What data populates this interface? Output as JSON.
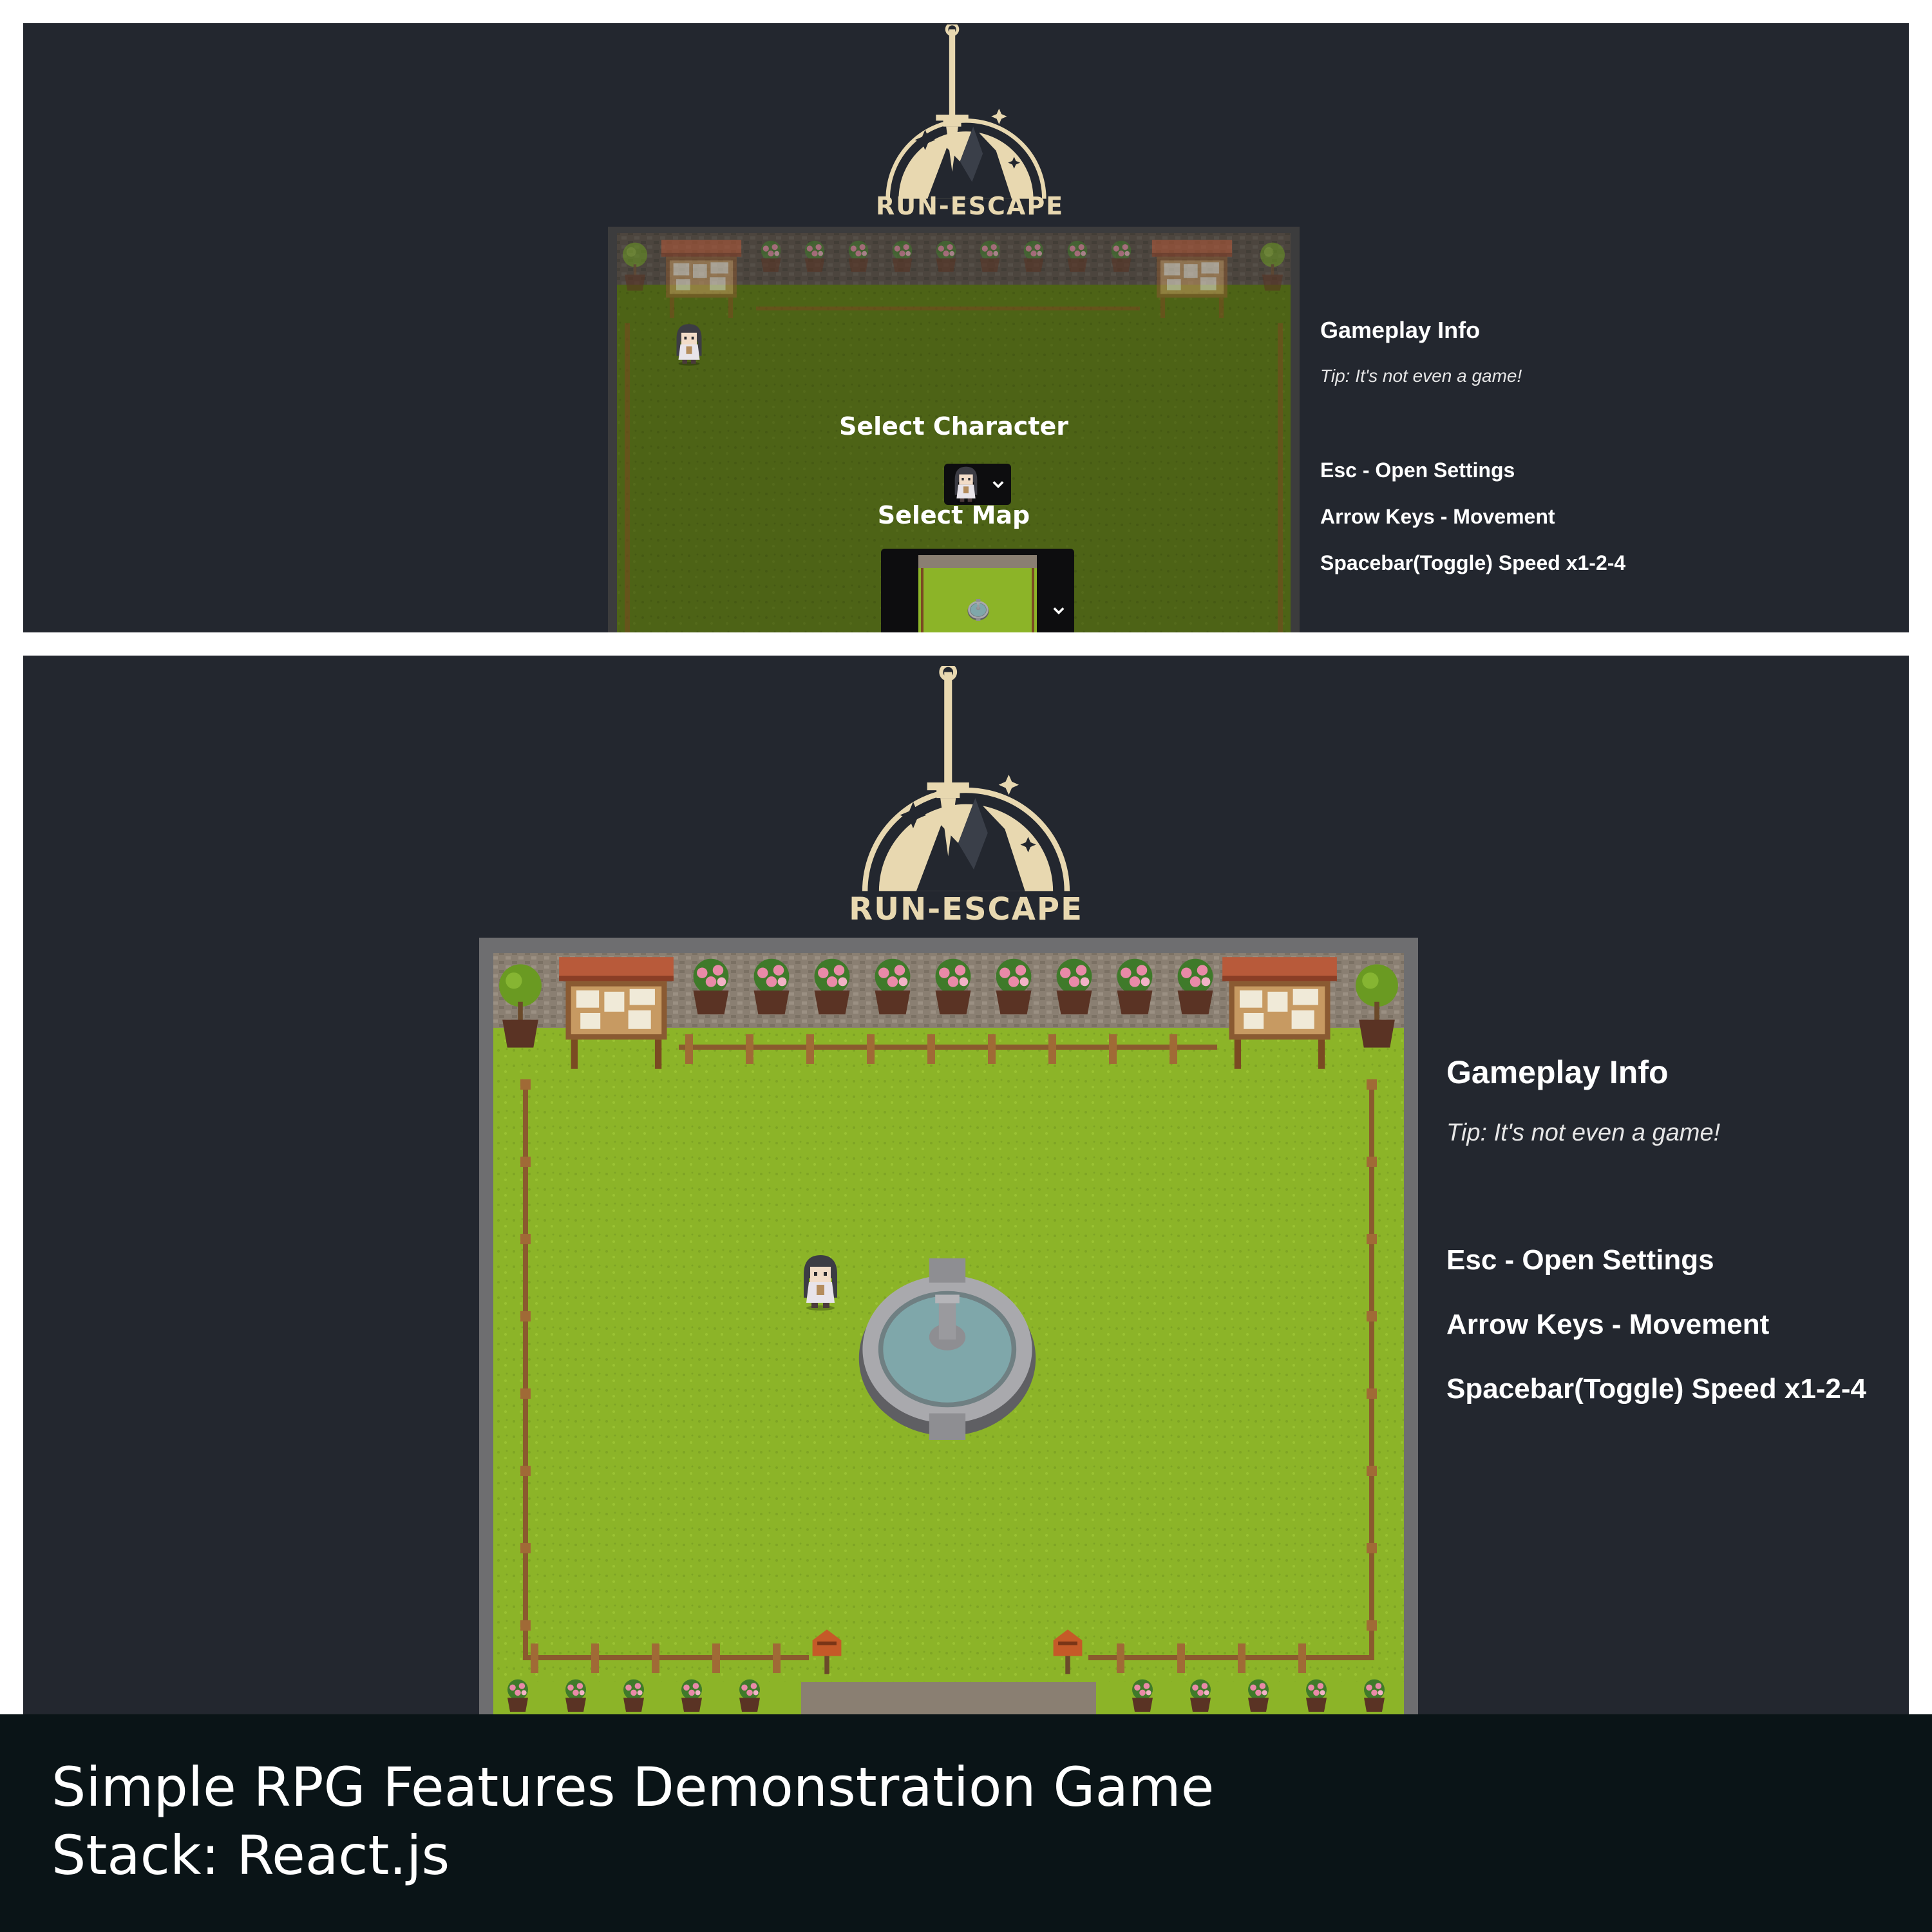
{
  "logo": {
    "wordmark": "RUN-ESCAPE"
  },
  "top_screen": {
    "menu": {
      "select_character_label": "Select Character",
      "select_map_label": "Select Map",
      "character_dropdown_icon": "chevron-down-icon",
      "map_dropdown_icon": "chevron-down-icon"
    }
  },
  "info": {
    "title": "Gameplay Info",
    "tip": "Tip: It's not even a game!",
    "controls": [
      "Esc - Open Settings",
      "Arrow Keys - Movement",
      "Spacebar(Toggle) Speed x1-2-4"
    ]
  },
  "caption": {
    "line1": "Simple RPG Features Demonstration Game",
    "line2": "Stack: React.js"
  },
  "colors": {
    "background": "#23272f",
    "logo": "#e8d8b0",
    "grass": "#8cb428",
    "caption_bar": "#0a1417"
  }
}
